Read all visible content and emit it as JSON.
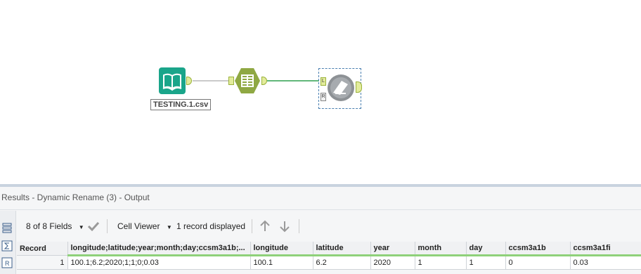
{
  "canvas": {
    "input_tool_label": "TESTING.1.csv",
    "join_anchor_left": "L",
    "join_anchor_right": "R"
  },
  "results": {
    "title": "Results - Dynamic Rename (3) - Output",
    "fields_selector": "8 of 8 Fields",
    "cell_viewer": "Cell Viewer",
    "records_displayed": "1 record displayed",
    "columns": [
      "Record",
      "longitude;latitude;year;month;day;ccsm3a1b;...",
      "longitude",
      "latitude",
      "year",
      "month",
      "day",
      "ccsm3a1b",
      "ccsm3a1fi"
    ],
    "rows": [
      [
        "1",
        "100.1;6.2;2020;1;1;0;0.03",
        "100.1",
        "6.2",
        "2020",
        "1",
        "1",
        "0",
        "0.03"
      ]
    ]
  },
  "colors": {
    "input_tool": "#1aa58a",
    "select_tool": "#8fa843",
    "dynamic_rename_tool": "#8d9195",
    "connection": "#2e9f4f",
    "header_underline": "#8fd17a"
  },
  "icons": [
    "book-icon",
    "select-tool-icon",
    "dynamic-rename-icon",
    "check-icon",
    "dropdown-arrow-icon",
    "arrow-up-icon",
    "arrow-down-icon",
    "list-icon",
    "sum-icon",
    "r-icon"
  ]
}
